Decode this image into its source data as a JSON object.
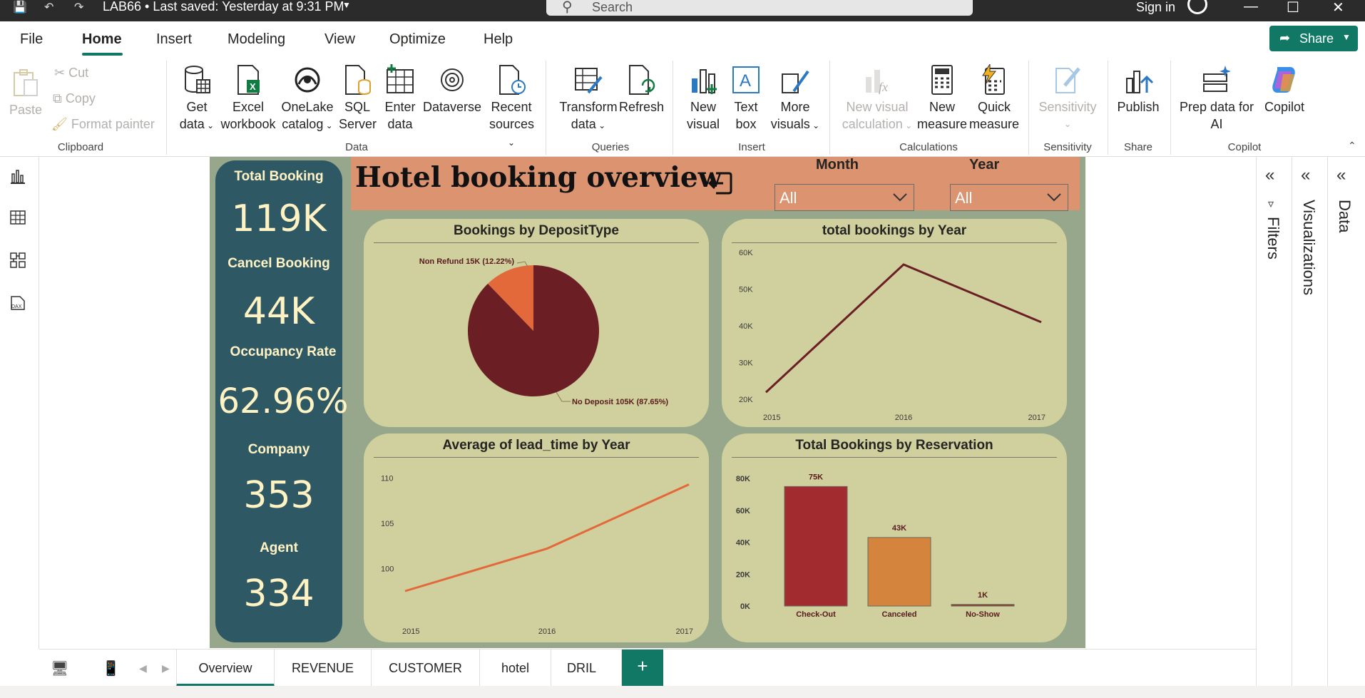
{
  "titlebar": {
    "title": "LAB66 • Last saved: Yesterday at 9:31 PM",
    "search_placeholder": "Search",
    "signin": "Sign in"
  },
  "menu": {
    "items": [
      "File",
      "Home",
      "Insert",
      "Modeling",
      "View",
      "Optimize",
      "Help"
    ],
    "active": "Home",
    "share_label": "Share"
  },
  "ribbon": {
    "clipboard": {
      "paste": "Paste",
      "cut": "Cut",
      "copy": "Copy",
      "format_painter": "Format painter",
      "group": "Clipboard"
    },
    "data": {
      "get_data": [
        "Get",
        "data"
      ],
      "excel": [
        "Excel",
        "workbook"
      ],
      "onelake": [
        "OneLake",
        "catalog"
      ],
      "sql": [
        "SQL",
        "Server"
      ],
      "enter": [
        "Enter",
        "data"
      ],
      "dataverse": [
        "Dataverse",
        ""
      ],
      "recent": [
        "Recent",
        "sources"
      ],
      "group": "Data"
    },
    "queries": {
      "transform": [
        "Transform",
        "data"
      ],
      "refresh": [
        "Refresh",
        ""
      ],
      "group": "Queries"
    },
    "insert": {
      "new_visual": [
        "New",
        "visual"
      ],
      "text_box": [
        "Text",
        "box"
      ],
      "more_visuals": [
        "More",
        "visuals"
      ],
      "group": "Insert"
    },
    "calculations": {
      "new_visual_calc": [
        "New visual",
        "calculation"
      ],
      "new_measure": [
        "New",
        "measure"
      ],
      "quick_measure": [
        "Quick",
        "measure"
      ],
      "group": "Calculations"
    },
    "sensitivity": {
      "label": "Sensitivity",
      "group": "Sensitivity"
    },
    "share": {
      "publish": "Publish",
      "group": "Share"
    },
    "copilot": {
      "prep": [
        "Prep data for",
        "AI"
      ],
      "copilot": "Copilot",
      "group": "Copilot"
    }
  },
  "report": {
    "title": "Hotel booking overview",
    "slicers": [
      {
        "title": "Month",
        "value": "All"
      },
      {
        "title": "Year",
        "value": "All"
      }
    ],
    "kpis": [
      {
        "label": "Total Booking",
        "value": "119K"
      },
      {
        "label": "Cancel Booking",
        "value": "44K"
      },
      {
        "label": "Occupancy Rate",
        "value": "62.96%"
      },
      {
        "label": "Company",
        "value": "353"
      },
      {
        "label": "Agent",
        "value": "334"
      }
    ]
  },
  "colors": {
    "report_bg": "#97a78c",
    "card_bg": "#cfd09d",
    "kpi_bg": "#2f5865",
    "kpi_text": "#fff3c4",
    "header_band": "#db9370",
    "accent_green": "#117865",
    "pie_no_deposit": "#6b1f24",
    "pie_non_refund": "#e3693a",
    "line_bookings": "#6b1f24",
    "line_lead": "#e3693a",
    "bar_checkout": "#a12b2e",
    "bar_canceled": "#d4843d",
    "bar_noshow": "#8a3a2a"
  },
  "chart_data": [
    {
      "type": "pie",
      "title": "Bookings by DepositType",
      "slices": [
        {
          "name": "No Deposit",
          "value": 105,
          "label": "No Deposit 105K (87.65%)",
          "percent": 87.65
        },
        {
          "name": "Non Refund",
          "value": 15,
          "label": "Non Refund 15K (12.22%)",
          "percent": 12.22
        }
      ]
    },
    {
      "type": "line",
      "title": "total bookings by Year",
      "x": [
        "2015",
        "2016",
        "2017"
      ],
      "series": [
        {
          "values": [
            21.9,
            56.7,
            41.0
          ]
        }
      ],
      "ylim": [
        20000,
        60000
      ],
      "yticks": [
        "20K",
        "30K",
        "40K",
        "50K",
        "60K"
      ],
      "ytick_values": [
        20,
        30,
        40,
        50,
        60
      ]
    },
    {
      "type": "line",
      "title": "Average of lead_time by Year",
      "x": [
        "2015",
        "2016",
        "2017"
      ],
      "series": [
        {
          "values": [
            97.5,
            102.2,
            109.3
          ]
        }
      ],
      "ylim": [
        96,
        111
      ],
      "yticks": [
        "100",
        "105",
        "110"
      ],
      "ytick_values": [
        100,
        105,
        110
      ]
    },
    {
      "type": "bar",
      "title": "Total Bookings by Reservation",
      "categories": [
        "Check-Out",
        "Canceled",
        "No-Show"
      ],
      "values": [
        75,
        43,
        1
      ],
      "data_labels": [
        "75K",
        "43K",
        "1K"
      ],
      "ylim": [
        0,
        85
      ],
      "yticks": [
        "0K",
        "20K",
        "40K",
        "60K",
        "80K"
      ],
      "ytick_values": [
        0,
        20,
        40,
        60,
        80
      ]
    }
  ],
  "tabs": {
    "items": [
      "Overview",
      "REVENUE",
      "CUSTOMER",
      "hotel",
      "DRIL"
    ],
    "active": "Overview",
    "add_label": "+"
  },
  "panes": {
    "filters": "Filters",
    "visualizations": "Visualizations",
    "data": "Data"
  }
}
